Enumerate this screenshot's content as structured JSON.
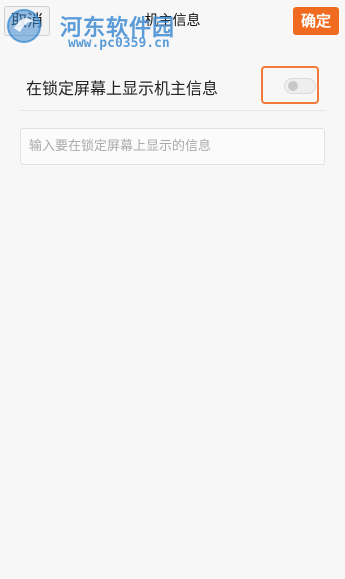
{
  "header": {
    "cancel_label": "取消",
    "title": "机主信息",
    "confirm_label": "确定"
  },
  "watermark": {
    "title": "河东软件园",
    "url": "www.pc0359.cn"
  },
  "settings": {
    "show_owner_info_label": "在锁定屏幕上显示机主信息",
    "show_owner_info_enabled": false
  },
  "owner_info_input": {
    "value": "",
    "placeholder": "输入要在锁定屏幕上显示的信息"
  },
  "colors": {
    "accent": "#f06a1f",
    "highlight": "#f07a3a",
    "background": "#f7f7f7",
    "watermark": "#408cd2"
  }
}
